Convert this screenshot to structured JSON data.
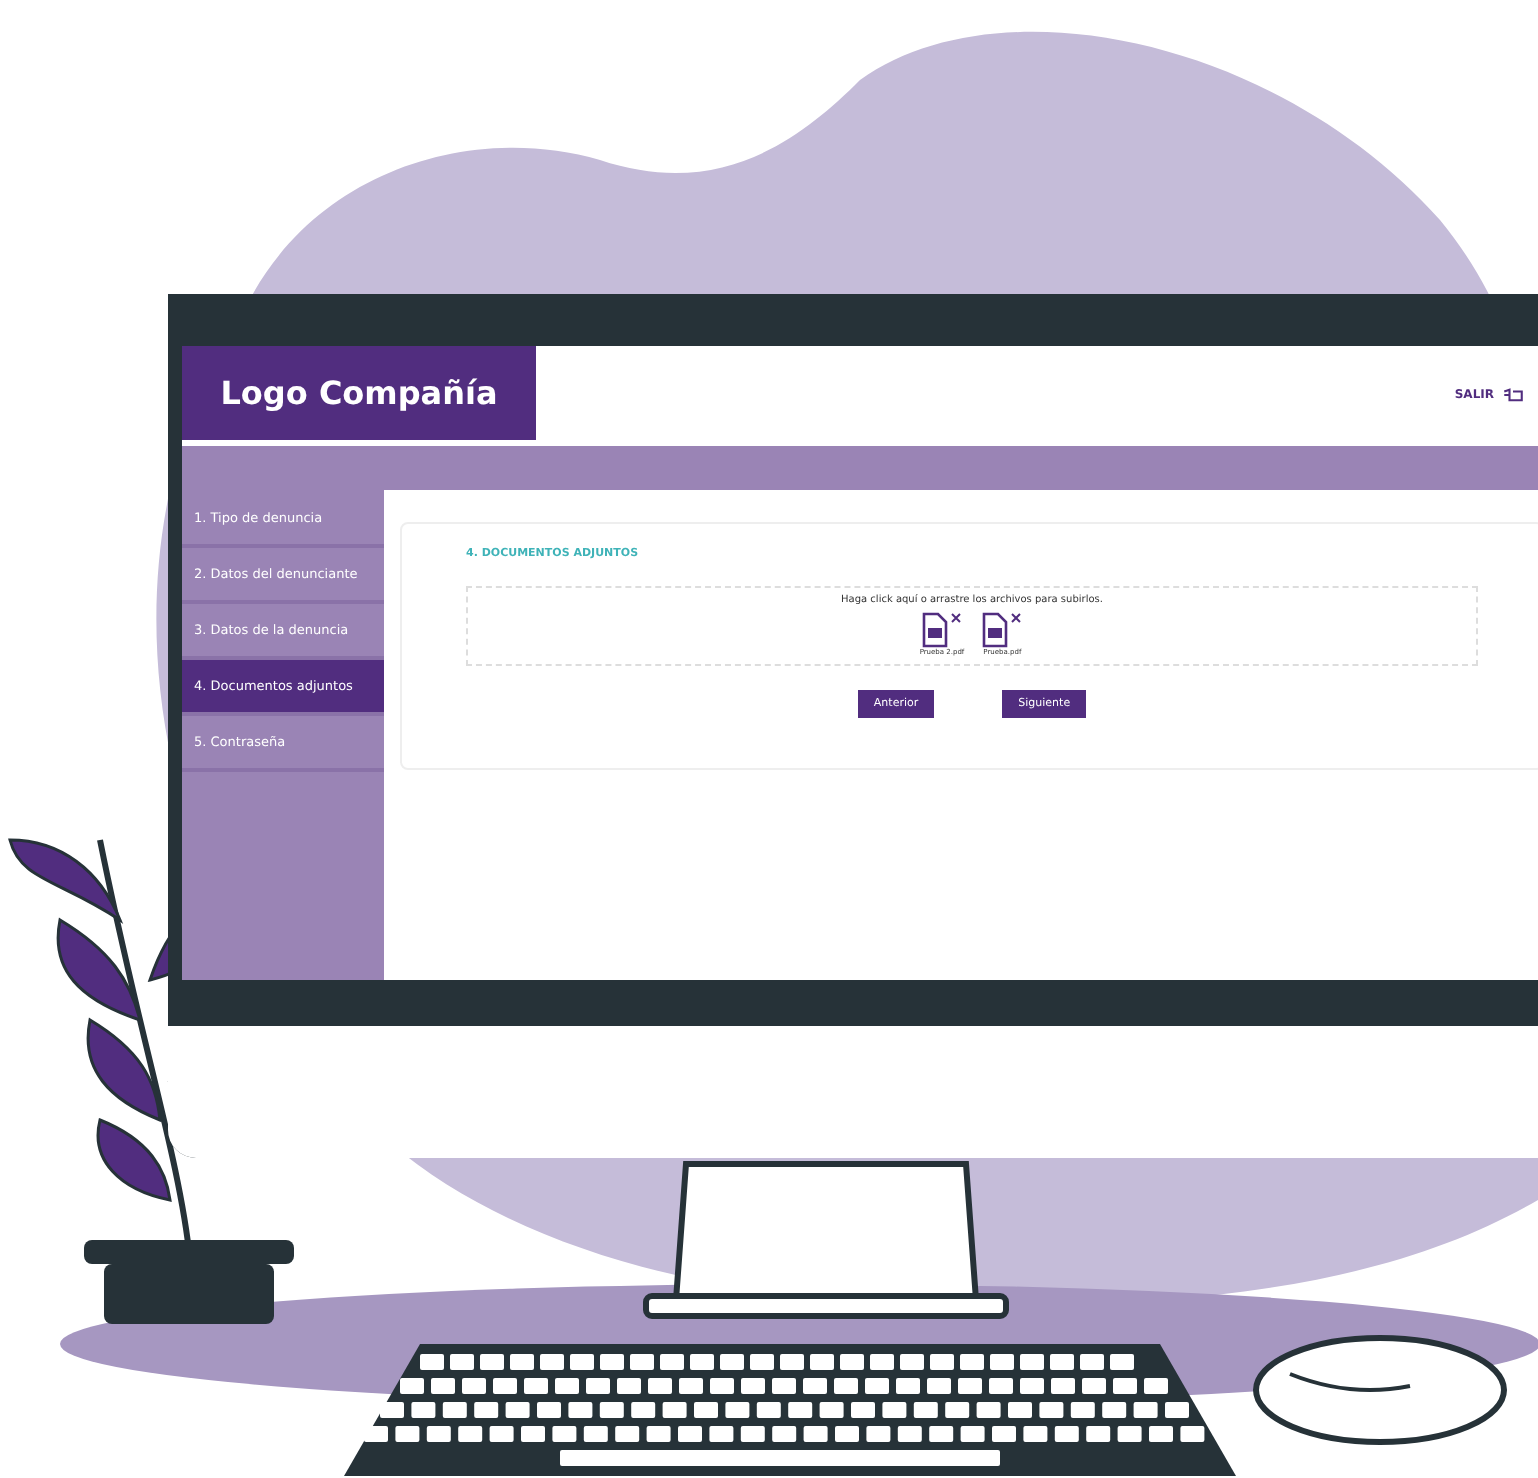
{
  "header": {
    "logo": "Logo Compañía",
    "logout": "SALIR"
  },
  "steps": [
    {
      "label": "1. Tipo de denuncia",
      "selected": false
    },
    {
      "label": "2. Datos del denunciante",
      "selected": false
    },
    {
      "label": "3. Datos de la denuncia",
      "selected": false
    },
    {
      "label": "4. Documentos adjuntos",
      "selected": true
    },
    {
      "label": "5. Contraseña",
      "selected": false
    }
  ],
  "section": {
    "title": "4. DOCUMENTOS ADJUNTOS",
    "hint": "Haga click aquí o arrastre los archivos para subirlos.",
    "files": [
      {
        "name": "Prueba 2.pdf"
      },
      {
        "name": "Prueba.pdf"
      }
    ]
  },
  "buttons": [
    {
      "label": "Anterior"
    },
    {
      "label": "Siguiente"
    }
  ]
}
